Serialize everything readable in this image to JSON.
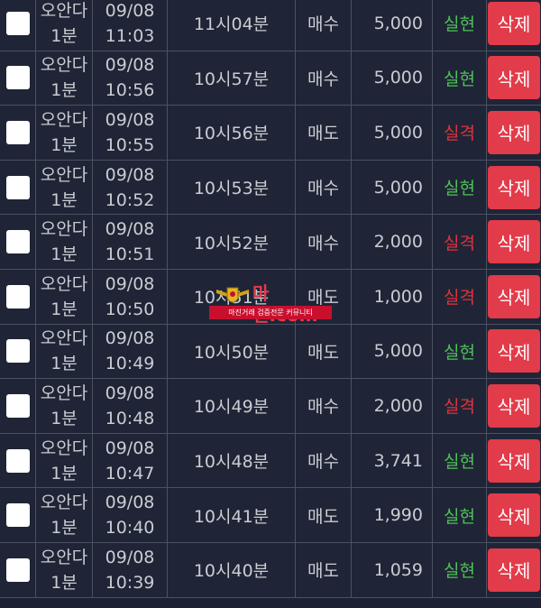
{
  "colors": {
    "background": "#1f2536",
    "grid_line": "#4a5160",
    "text": "#c9ccd2",
    "delete_button": "#e23b4a",
    "result_hit": "#4fc058",
    "result_miss": "#e0323e"
  },
  "delete_label": "삭제",
  "rows": [
    {
      "game_line1": "오안다",
      "game_line2": "1분",
      "date": "09/08",
      "time": "11:03",
      "round": "11시04분",
      "type": "매수",
      "amount": "5,000",
      "result": "실현",
      "result_kind": "hit"
    },
    {
      "game_line1": "오안다",
      "game_line2": "1분",
      "date": "09/08",
      "time": "10:56",
      "round": "10시57분",
      "type": "매수",
      "amount": "5,000",
      "result": "실현",
      "result_kind": "hit"
    },
    {
      "game_line1": "오안다",
      "game_line2": "1분",
      "date": "09/08",
      "time": "10:55",
      "round": "10시56분",
      "type": "매도",
      "amount": "5,000",
      "result": "실격",
      "result_kind": "miss"
    },
    {
      "game_line1": "오안다",
      "game_line2": "1분",
      "date": "09/08",
      "time": "10:52",
      "round": "10시53분",
      "type": "매수",
      "amount": "5,000",
      "result": "실현",
      "result_kind": "hit"
    },
    {
      "game_line1": "오안다",
      "game_line2": "1분",
      "date": "09/08",
      "time": "10:51",
      "round": "10시52분",
      "type": "매수",
      "amount": "2,000",
      "result": "실격",
      "result_kind": "miss"
    },
    {
      "game_line1": "오안다",
      "game_line2": "1분",
      "date": "09/08",
      "time": "10:50",
      "round": "10시51분",
      "type": "매도",
      "amount": "1,000",
      "result": "실격",
      "result_kind": "miss"
    },
    {
      "game_line1": "오안다",
      "game_line2": "1분",
      "date": "09/08",
      "time": "10:49",
      "round": "10시50분",
      "type": "매도",
      "amount": "5,000",
      "result": "실현",
      "result_kind": "hit"
    },
    {
      "game_line1": "오안다",
      "game_line2": "1분",
      "date": "09/08",
      "time": "10:48",
      "round": "10시49분",
      "type": "매수",
      "amount": "2,000",
      "result": "실격",
      "result_kind": "miss"
    },
    {
      "game_line1": "오안다",
      "game_line2": "1분",
      "date": "09/08",
      "time": "10:47",
      "round": "10시48분",
      "type": "매수",
      "amount": "3,741",
      "result": "실현",
      "result_kind": "hit"
    },
    {
      "game_line1": "오안다",
      "game_line2": "1분",
      "date": "09/08",
      "time": "10:40",
      "round": "10시41분",
      "type": "매도",
      "amount": "1,990",
      "result": "실현",
      "result_kind": "hit"
    },
    {
      "game_line1": "오안다",
      "game_line2": "1분",
      "date": "09/08",
      "time": "10:39",
      "round": "10시40분",
      "type": "매도",
      "amount": "1,059",
      "result": "실현",
      "result_kind": "hit"
    }
  ],
  "watermark": {
    "title": "마진.com",
    "tagline": "마진거래 검증전문 커뮤니티",
    "emblem_icon": "winged-shield-icon"
  }
}
